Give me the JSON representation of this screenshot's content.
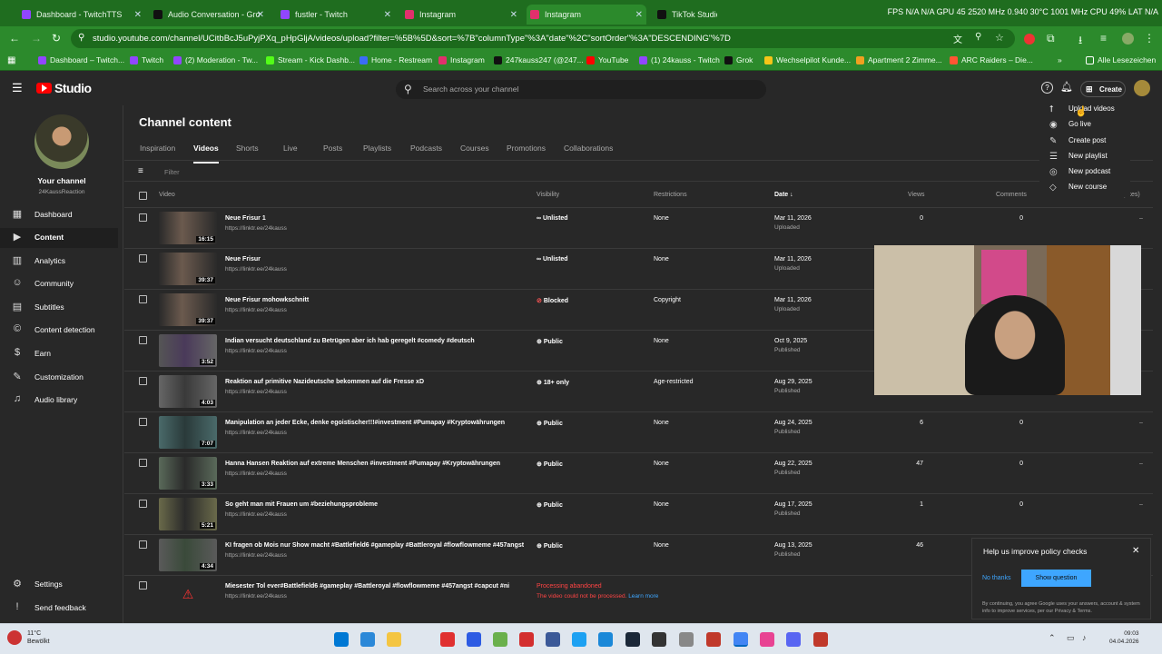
{
  "browser": {
    "tabs": [
      {
        "label": "Dashboard - TwitchTTS",
        "color": "#9146ff"
      },
      {
        "label": "Audio Conversation - Gro",
        "color": "#111111"
      },
      {
        "label": "fustler - Twitch",
        "color": "#9146ff"
      },
      {
        "label": "Instagram",
        "color": "#e1306c"
      },
      {
        "label": "Instagram",
        "color": "#e1306c"
      },
      {
        "label": "TikTok Studio",
        "color": "#111111"
      }
    ],
    "tray_text": "FPS N/A N/A GPU 45 2520 MHz 0.940 30°C 1001 MHz CPU 49% LAT N/A",
    "url": "studio.youtube.com/channel/UCitbBcJ5uPyjPXq_pHpGljA/videos/upload?filter=%5B%5D&sort=%7B\"columnType\"%3A\"date\"%2C\"sortOrder\"%3A\"DESCENDING\"%7D",
    "bookmarks": [
      {
        "label": "Dashboard – Twitch...",
        "color": "#9146ff"
      },
      {
        "label": "Twitch",
        "color": "#9146ff"
      },
      {
        "label": "(2) Moderation - Tw...",
        "color": "#9146ff"
      },
      {
        "label": "Stream - Kick Dashb...",
        "color": "#53fc18"
      },
      {
        "label": "Home - Restream",
        "color": "#3b6cf6"
      },
      {
        "label": "Instagram",
        "color": "#e1306c"
      },
      {
        "label": "247kauss247 (@247...",
        "color": "#111111"
      },
      {
        "label": "YouTube",
        "color": "#ff0000"
      },
      {
        "label": "(1) 24kauss - Twitch",
        "color": "#9146ff"
      },
      {
        "label": "Grok",
        "color": "#111111"
      },
      {
        "label": "Wechselpilot Kunde...",
        "color": "#f5c518"
      },
      {
        "label": "Apartment 2 Zimme...",
        "color": "#f0a020"
      },
      {
        "label": "ARC Raiders – Die...",
        "color": "#ff5533"
      }
    ],
    "all_bookmarks": "Alle Lesezeichen"
  },
  "studio": {
    "logo": "Studio",
    "search_placeholder": "Search across your channel",
    "create": "Create"
  },
  "channel": {
    "your_channel": "Your channel",
    "name": "24KaussReaction"
  },
  "sidebar": [
    {
      "label": "Dashboard",
      "icon": "▦"
    },
    {
      "label": "Content",
      "icon": "▶"
    },
    {
      "label": "Analytics",
      "icon": "▥"
    },
    {
      "label": "Community",
      "icon": "☺"
    },
    {
      "label": "Subtitles",
      "icon": "▤"
    },
    {
      "label": "Content detection",
      "icon": "©"
    },
    {
      "label": "Earn",
      "icon": "$"
    },
    {
      "label": "Customization",
      "icon": "✎"
    },
    {
      "label": "Audio library",
      "icon": "♫"
    }
  ],
  "sidebar_bottom": [
    {
      "label": "Settings",
      "icon": "⚙"
    },
    {
      "label": "Send feedback",
      "icon": "!"
    }
  ],
  "page_title": "Channel content",
  "tabs": [
    "Inspiration",
    "Videos",
    "Shorts",
    "Live",
    "Posts",
    "Playlists",
    "Podcasts",
    "Courses",
    "Promotions",
    "Collaborations"
  ],
  "filter_label": "Filter",
  "columns": {
    "video": "Video",
    "visibility": "Visibility",
    "restrictions": "Restrictions",
    "date": "Date",
    "views": "Views",
    "comments": "Comments",
    "likes": "(likes)"
  },
  "rows": [
    {
      "title": "Neue Frisur 1",
      "desc": "https://linktr.ee/24kauss",
      "duration": "16:15",
      "visibility": "Unlisted",
      "vis_icon": "∞",
      "restrictions": "None",
      "date": "Mar 11, 2026",
      "date_status": "Uploaded",
      "views": "0",
      "comments": "0",
      "likes": "–"
    },
    {
      "title": "Neue Frisur",
      "desc": "https://linktr.ee/24kauss",
      "duration": "39:37",
      "visibility": "Unlisted",
      "vis_icon": "∞",
      "restrictions": "None",
      "date": "Mar 11, 2026",
      "date_status": "Uploaded",
      "views": "",
      "comments": "",
      "likes": ""
    },
    {
      "title": "Neue Frisur mohowkschnitt",
      "desc": "https://linktr.ee/24kauss",
      "duration": "39:37",
      "visibility": "Blocked",
      "vis_icon": "⊘",
      "restrictions": "Copyright",
      "date": "Mar 11, 2026",
      "date_status": "Uploaded",
      "views": "",
      "comments": "",
      "likes": ""
    },
    {
      "title": "Indian versucht deutschland zu Betrügen aber ich hab geregelt #comedy #deutsch",
      "desc": "https://linktr.ee/24kauss",
      "duration": "3:52",
      "visibility": "Public",
      "vis_icon": "⊕",
      "restrictions": "None",
      "date": "Oct 9, 2025",
      "date_status": "Published",
      "views": "",
      "comments": "",
      "likes": ""
    },
    {
      "title": "Reaktion auf primitive Nazideutsche bekommen auf die Fresse xD",
      "desc": "https://linktr.ee/24kauss",
      "duration": "4:03",
      "visibility": "18+ only",
      "vis_icon": "⊕",
      "restrictions": "Age-restricted",
      "date": "Aug 29, 2025",
      "date_status": "Published",
      "views": "",
      "comments": "",
      "likes": ""
    },
    {
      "title": "Manipulation an jeder Ecke, denke egoistischer!!!#investment #Pumapay #Kryptowährungen",
      "desc": "https://linktr.ee/24kauss",
      "duration": "7:07",
      "visibility": "Public",
      "vis_icon": "⊕",
      "restrictions": "None",
      "date": "Aug 24, 2025",
      "date_status": "Published",
      "views": "6",
      "comments": "0",
      "likes": "–"
    },
    {
      "title": "Hanna Hansen Reaktion auf extreme Menschen #investment #Pumapay #Kryptowährungen",
      "desc": "https://linktr.ee/24kauss",
      "duration": "3:33",
      "visibility": "Public",
      "vis_icon": "⊕",
      "restrictions": "None",
      "date": "Aug 22, 2025",
      "date_status": "Published",
      "views": "47",
      "comments": "0",
      "likes": "–"
    },
    {
      "title": "So geht man mit Frauen um #beziehungsprobleme",
      "desc": "https://linktr.ee/24kauss",
      "duration": "5:21",
      "visibility": "Public",
      "vis_icon": "⊕",
      "restrictions": "None",
      "date": "Aug 17, 2025",
      "date_status": "Published",
      "views": "1",
      "comments": "0",
      "likes": "–"
    },
    {
      "title": "KI fragen ob Mois nur Show macht #Battlefield6 #gameplay #Battleroyal #flowflowmeme #457angst",
      "desc": "https://linktr.ee/24kauss",
      "duration": "4:34",
      "visibility": "Public",
      "vis_icon": "⊕",
      "restrictions": "None",
      "date": "Aug 13, 2025",
      "date_status": "Published",
      "views": "46",
      "comments": "",
      "likes": ""
    },
    {
      "title": "Miesester Tol ever#Battlefield6 #gameplay #Battleroyal #flowflowmeme #457angst #capcut #ni",
      "desc": "https://linktr.ee/24kauss",
      "duration": "",
      "visibility": "Processing abandoned",
      "vis_icon": "",
      "restrictions": "",
      "date": "",
      "date_status": "",
      "views": "",
      "comments": "",
      "likes": ""
    }
  ],
  "processing_note": "The video could not be processed.",
  "learn_more": "Learn more",
  "create_menu": [
    {
      "label": "Upload videos",
      "icon": "⭡"
    },
    {
      "label": "Go live",
      "icon": "◉"
    },
    {
      "label": "Create post",
      "icon": "✎"
    },
    {
      "label": "New playlist",
      "icon": "☰"
    },
    {
      "label": "New podcast",
      "icon": "◎"
    },
    {
      "label": "New course",
      "icon": "◇"
    }
  ],
  "policy": {
    "title": "Help us improve policy checks",
    "no_thanks": "No thanks",
    "show_question": "Show question",
    "legal": "By continuing, you agree Google uses your answers, account & system info to improve services, per our Privacy & Terms."
  },
  "taskbar": {
    "weather_temp": "11°C",
    "weather_desc": "Bewölkt",
    "time": "09:03",
    "date": "04.04.2026",
    "apps": [
      "#0078d4",
      "#2b88d8",
      "#f4c542",
      "#e03030",
      "#2d5be3",
      "#6ab04c",
      "#d32f2f",
      "#3b5998",
      "#1da1f2",
      "#1b2838",
      "#333333",
      "#888888",
      "#c0392b",
      "#4285f4",
      "#e84393",
      "#5865f2",
      "#c0392b"
    ]
  }
}
